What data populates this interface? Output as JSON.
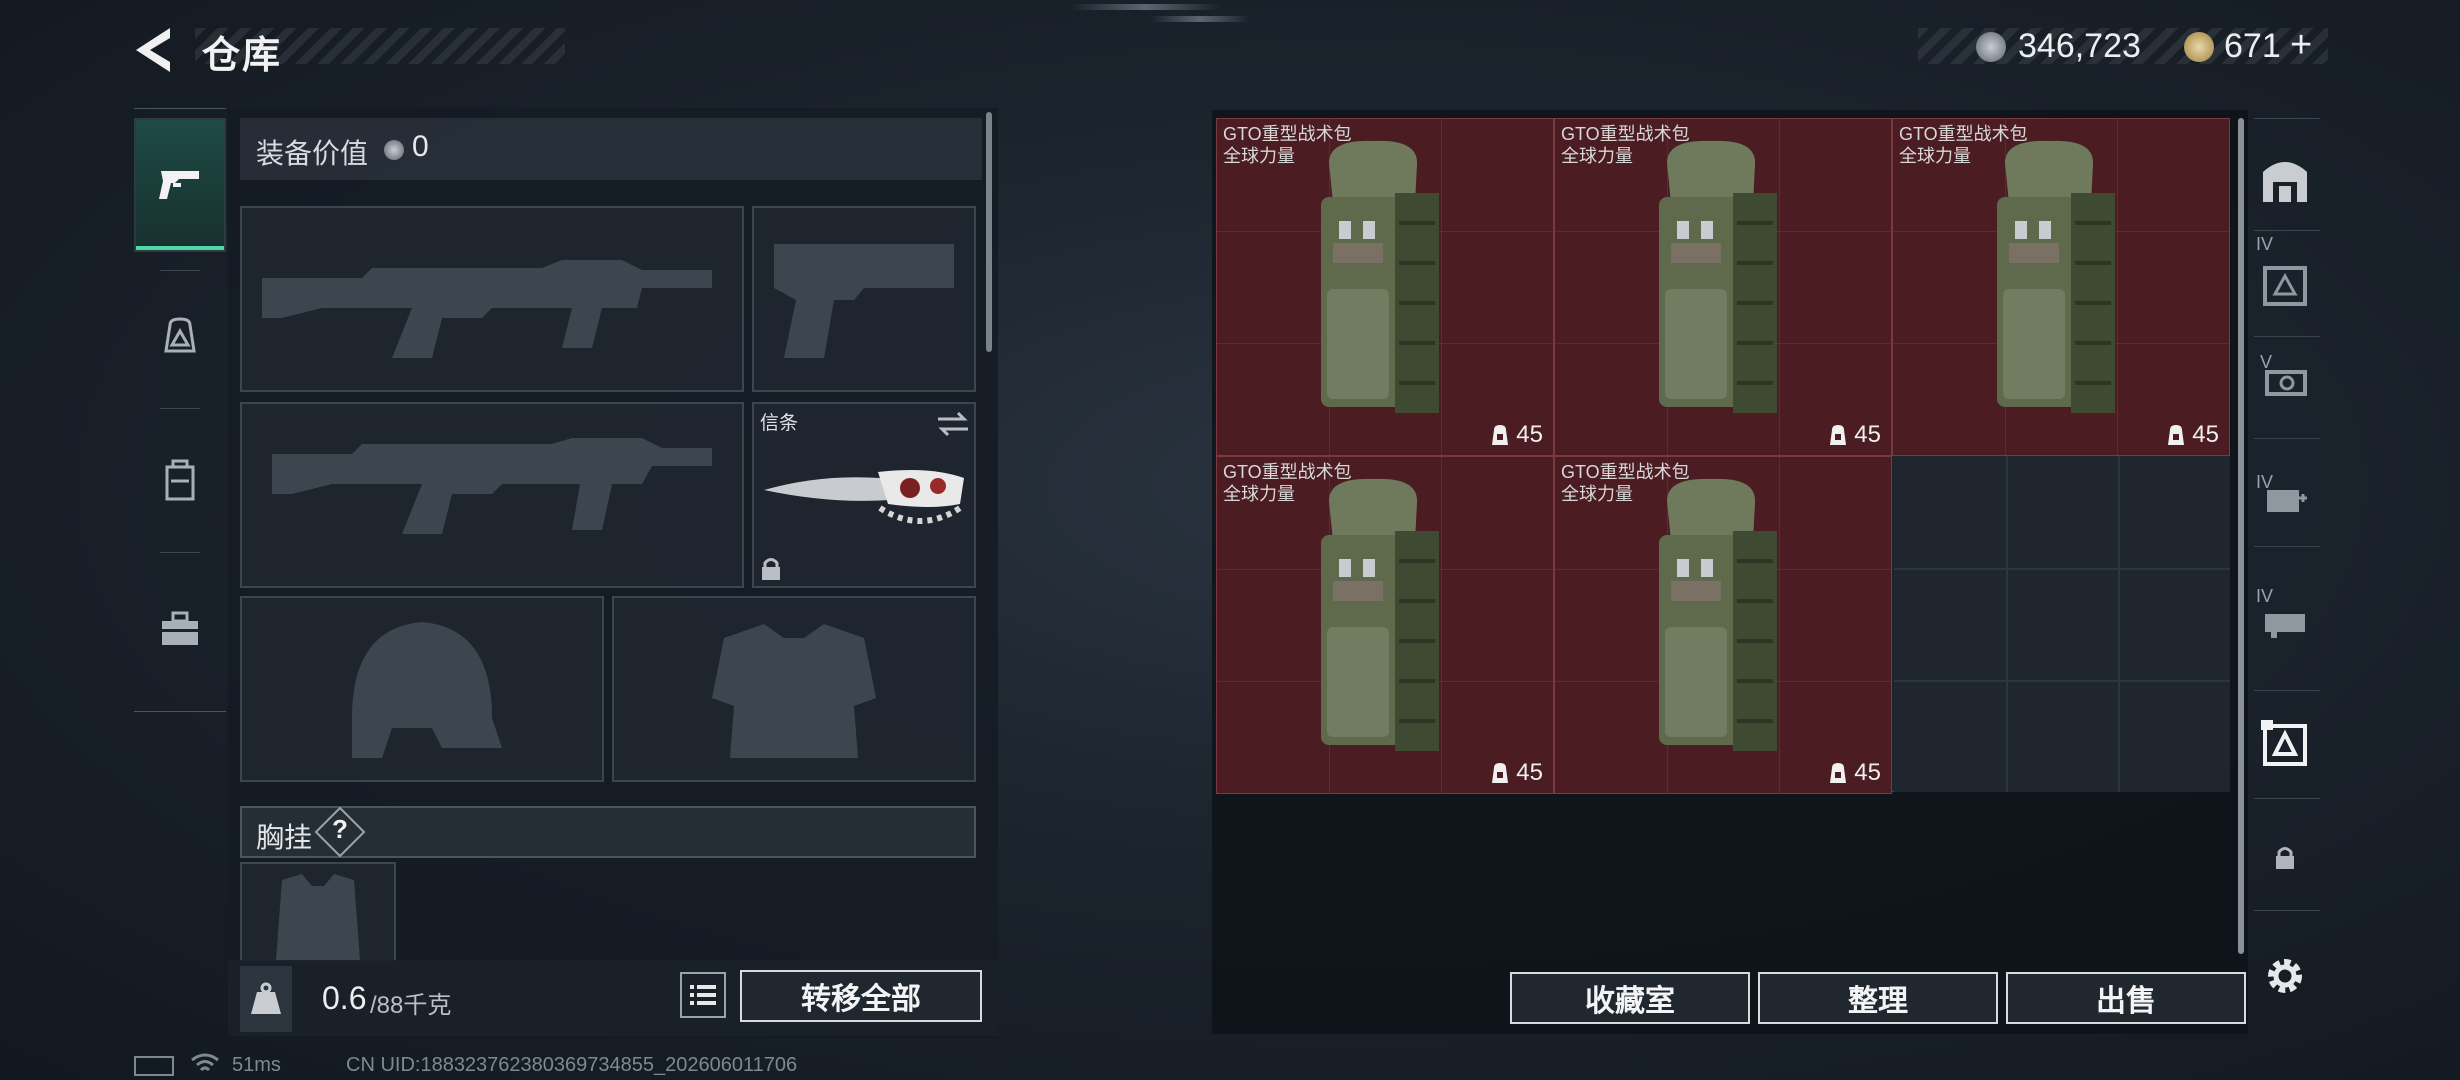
{
  "header": {
    "title": "仓库",
    "currency_silver": "346,723",
    "currency_gold": "671",
    "currency_add": "+"
  },
  "left_nav": {
    "items": [
      {
        "name": "pistol-icon",
        "active": true
      },
      {
        "name": "backpack-icon",
        "active": false
      },
      {
        "name": "chest-rig-icon",
        "active": false
      },
      {
        "name": "toolbox-icon",
        "active": false
      }
    ]
  },
  "equipment": {
    "value_label": "装备价值",
    "value": "0",
    "melee_label": "信条",
    "chest_rig_label": "胸挂",
    "help": "?"
  },
  "capacity": {
    "current": "0.6",
    "max": "/88千克"
  },
  "actions": {
    "transfer_all": "转移全部",
    "collection": "收藏室",
    "sort": "整理",
    "sell": "出售"
  },
  "storage": {
    "items": [
      {
        "name": "GTO重型战术包",
        "sub": "全球力量",
        "count": "45"
      },
      {
        "name": "GTO重型战术包",
        "sub": "全球力量",
        "count": "45"
      },
      {
        "name": "GTO重型战术包",
        "sub": "全球力量",
        "count": "45"
      },
      {
        "name": "GTO重型战术包",
        "sub": "全球力量",
        "count": "45"
      },
      {
        "name": "GTO重型战术包",
        "sub": "全球力量",
        "count": "45"
      }
    ]
  },
  "right_nav": {
    "tier_labels": [
      "IV",
      "V",
      "IV",
      "IV"
    ]
  },
  "footer": {
    "ping": "51ms",
    "uid": "CN UID:1883237623803697348​55_202606011706"
  }
}
